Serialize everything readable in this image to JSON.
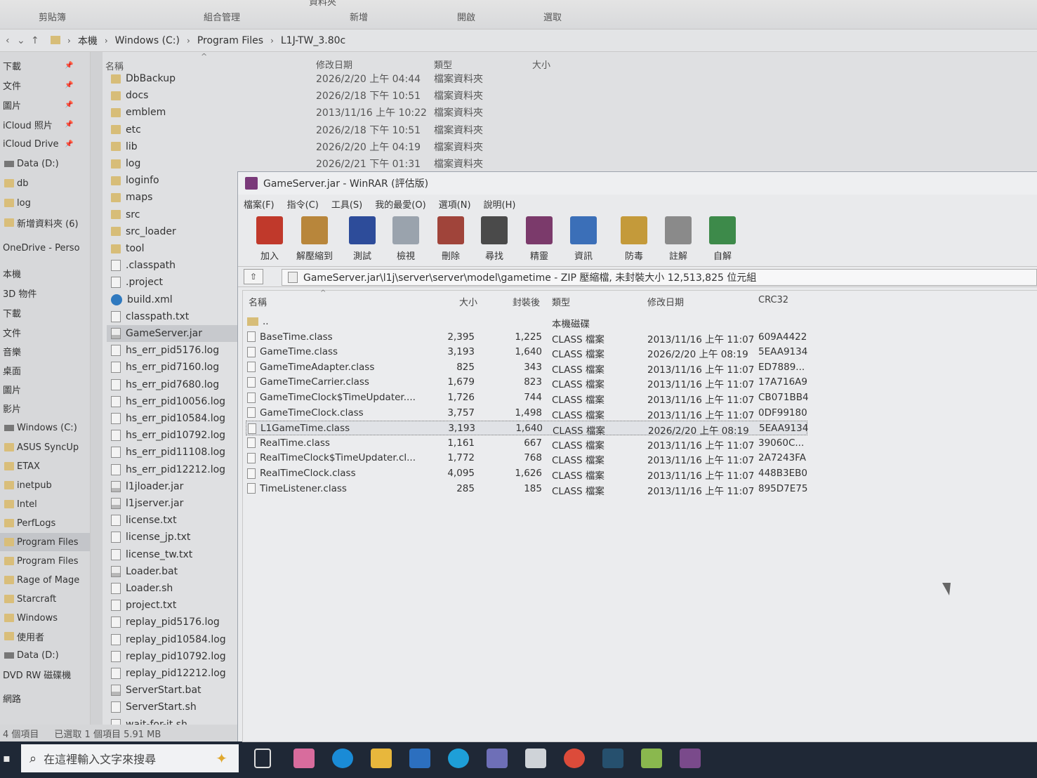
{
  "ribbon": {
    "groups": [
      "剪貼簿",
      "組合管理",
      "新增",
      "開啟",
      "選取"
    ],
    "title_fragment": "資料夾"
  },
  "address": {
    "crumbs": [
      "本機",
      "Windows (C:)",
      "Program Files",
      "L1J-TW_3.80c"
    ]
  },
  "nav": {
    "items": [
      "下載",
      "文件",
      "圖片",
      "iCloud 照片",
      "iCloud Drive",
      "Data (D:)",
      "db",
      "log",
      "新增資料夾 (6)",
      "OneDrive - Perso",
      "本機",
      "3D 物件",
      "下載",
      "文件",
      "音樂",
      "桌面",
      "圖片",
      "影片",
      "Windows (C:)",
      "ASUS SyncUp",
      "ETAX",
      "inetpub",
      "Intel",
      "PerfLogs",
      "Program Files",
      "Program Files",
      "Rage of Mage",
      "Starcraft",
      "Windows",
      "使用者",
      "Data (D:)",
      "DVD RW 磁碟機",
      "網路"
    ]
  },
  "files": {
    "headers": {
      "name": "名稱",
      "date": "修改日期",
      "type": "類型",
      "size": "大小"
    },
    "items": [
      {
        "name": "DbBackup",
        "icon": "folder",
        "date": "2026/2/20 上午 04:44",
        "type": "檔案資料夾"
      },
      {
        "name": "docs",
        "icon": "folder",
        "date": "2026/2/18 下午 10:51",
        "type": "檔案資料夾"
      },
      {
        "name": "emblem",
        "icon": "folder",
        "date": "2013/11/16 上午 10:22",
        "type": "檔案資料夾"
      },
      {
        "name": "etc",
        "icon": "folder",
        "date": "2026/2/18 下午 10:51",
        "type": "檔案資料夾"
      },
      {
        "name": "lib",
        "icon": "folder",
        "date": "2026/2/20 上午 04:19",
        "type": "檔案資料夾"
      },
      {
        "name": "log",
        "icon": "folder",
        "date": "2026/2/21 下午 01:31",
        "type": "檔案資料夾"
      },
      {
        "name": "loginfo",
        "icon": "folder"
      },
      {
        "name": "maps",
        "icon": "folder"
      },
      {
        "name": "src",
        "icon": "folder"
      },
      {
        "name": "src_loader",
        "icon": "folder"
      },
      {
        "name": "tool",
        "icon": "folder"
      },
      {
        "name": ".classpath",
        "icon": "doc"
      },
      {
        "name": ".project",
        "icon": "doc"
      },
      {
        "name": "build.xml",
        "icon": "xml"
      },
      {
        "name": "classpath.txt",
        "icon": "doc"
      },
      {
        "name": "GameServer.jar",
        "icon": "jar"
      },
      {
        "name": "hs_err_pid5176.log",
        "icon": "doc"
      },
      {
        "name": "hs_err_pid7160.log",
        "icon": "doc"
      },
      {
        "name": "hs_err_pid7680.log",
        "icon": "doc"
      },
      {
        "name": "hs_err_pid10056.log",
        "icon": "doc"
      },
      {
        "name": "hs_err_pid10584.log",
        "icon": "doc"
      },
      {
        "name": "hs_err_pid10792.log",
        "icon": "doc"
      },
      {
        "name": "hs_err_pid11108.log",
        "icon": "doc"
      },
      {
        "name": "hs_err_pid12212.log",
        "icon": "doc"
      },
      {
        "name": "l1jloader.jar",
        "icon": "jar"
      },
      {
        "name": "l1jserver.jar",
        "icon": "jar"
      },
      {
        "name": "license.txt",
        "icon": "doc"
      },
      {
        "name": "license_jp.txt",
        "icon": "doc"
      },
      {
        "name": "license_tw.txt",
        "icon": "doc"
      },
      {
        "name": "Loader.bat",
        "icon": "jar"
      },
      {
        "name": "Loader.sh",
        "icon": "doc"
      },
      {
        "name": "project.txt",
        "icon": "doc"
      },
      {
        "name": "replay_pid5176.log",
        "icon": "doc"
      },
      {
        "name": "replay_pid10584.log",
        "icon": "doc"
      },
      {
        "name": "replay_pid10792.log",
        "icon": "doc"
      },
      {
        "name": "replay_pid12212.log",
        "icon": "doc"
      },
      {
        "name": "ServerStart.bat",
        "icon": "jar"
      },
      {
        "name": "ServerStart.sh",
        "icon": "doc"
      },
      {
        "name": "wait-for-it.sh",
        "icon": "doc"
      }
    ]
  },
  "status": {
    "count": "4 個項目",
    "selected": "已選取 1 個項目  5.91 MB"
  },
  "taskbar": {
    "search_placeholder": "在這裡輸入文字來搜尋"
  },
  "winrar": {
    "title": "GameServer.jar - WinRAR (評估版)",
    "menu": [
      "檔案(F)",
      "指令(C)",
      "工具(S)",
      "我的最愛(O)",
      "選項(N)",
      "說明(H)"
    ],
    "tools": [
      {
        "label": "加入",
        "color": "#c0392b"
      },
      {
        "label": "解壓縮到",
        "color": "#b8863b"
      },
      {
        "label": "測試",
        "color": "#2d4c9a"
      },
      {
        "label": "檢視",
        "color": "#9aa3ad"
      },
      {
        "label": "刪除",
        "color": "#a0443a"
      },
      {
        "label": "尋找",
        "color": "#4a4a4a"
      },
      {
        "label": "精靈",
        "color": "#7b3a6b"
      },
      {
        "label": "資訊",
        "color": "#3b6fb8"
      },
      {
        "label": "防毒",
        "color": "#c49a3a"
      },
      {
        "label": "註解",
        "color": "#8a8a8a"
      },
      {
        "label": "自解",
        "color": "#3d8a4a"
      }
    ],
    "path": "GameServer.jar\\l1j\\server\\server\\model\\gametime - ZIP 壓縮檔, 未封裝大小 12,513,825 位元組",
    "columns": {
      "name": "名稱",
      "size": "大小",
      "packed": "封裝後",
      "type": "類型",
      "modified": "修改日期",
      "crc": "CRC32"
    },
    "rows": [
      {
        "name": "..",
        "size": "",
        "packed": "",
        "type": "本機磁碟",
        "modified": "",
        "crc": "",
        "folder": true
      },
      {
        "name": "BaseTime.class",
        "size": "2,395",
        "packed": "1,225",
        "type": "CLASS 檔案",
        "modified": "2013/11/16 上午 11:07",
        "crc": "609A4422"
      },
      {
        "name": "GameTime.class",
        "size": "3,193",
        "packed": "1,640",
        "type": "CLASS 檔案",
        "modified": "2026/2/20 上午 08:19",
        "crc": "5EAA9134"
      },
      {
        "name": "GameTimeAdapter.class",
        "size": "825",
        "packed": "343",
        "type": "CLASS 檔案",
        "modified": "2013/11/16 上午 11:07",
        "crc": "ED7889..."
      },
      {
        "name": "GameTimeCarrier.class",
        "size": "1,679",
        "packed": "823",
        "type": "CLASS 檔案",
        "modified": "2013/11/16 上午 11:07",
        "crc": "17A716A9"
      },
      {
        "name": "GameTimeClock$TimeUpdater....",
        "size": "1,726",
        "packed": "744",
        "type": "CLASS 檔案",
        "modified": "2013/11/16 上午 11:07",
        "crc": "CB071BB4"
      },
      {
        "name": "GameTimeClock.class",
        "size": "3,757",
        "packed": "1,498",
        "type": "CLASS 檔案",
        "modified": "2013/11/16 上午 11:07",
        "crc": "0DF99180"
      },
      {
        "name": "L1GameTime.class",
        "size": "3,193",
        "packed": "1,640",
        "type": "CLASS 檔案",
        "modified": "2026/2/20 上午 08:19",
        "crc": "5EAA9134",
        "selected": true
      },
      {
        "name": "RealTime.class",
        "size": "1,161",
        "packed": "667",
        "type": "CLASS 檔案",
        "modified": "2013/11/16 上午 11:07",
        "crc": "39060C..."
      },
      {
        "name": "RealTimeClock$TimeUpdater.cl...",
        "size": "1,772",
        "packed": "768",
        "type": "CLASS 檔案",
        "modified": "2013/11/16 上午 11:07",
        "crc": "2A7243FA"
      },
      {
        "name": "RealTimeClock.class",
        "size": "4,095",
        "packed": "1,626",
        "type": "CLASS 檔案",
        "modified": "2013/11/16 上午 11:07",
        "crc": "448B3EB0"
      },
      {
        "name": "TimeListener.class",
        "size": "285",
        "packed": "185",
        "type": "CLASS 檔案",
        "modified": "2013/11/16 上午 11:07",
        "crc": "895D7E75"
      }
    ]
  }
}
